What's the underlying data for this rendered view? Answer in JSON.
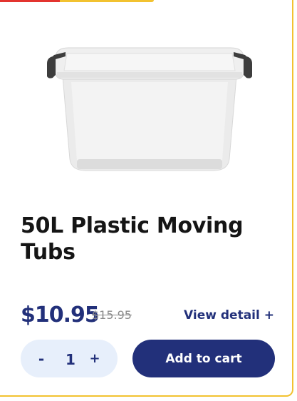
{
  "colors": {
    "accent_navy": "#22307a",
    "border_yellow": "#f2c230",
    "strip_red": "#e3342f",
    "stepper_bg": "#e7effb"
  },
  "product": {
    "image_name": "plastic-storage-tub-image",
    "title": "50L Plastic Moving Tubs",
    "price": "$10.95",
    "old_price": "$15.95",
    "view_detail": "View detail +"
  },
  "quantity": {
    "minus": "-",
    "value": "1",
    "plus": "+"
  },
  "cart": {
    "add_label": "Add to cart"
  }
}
